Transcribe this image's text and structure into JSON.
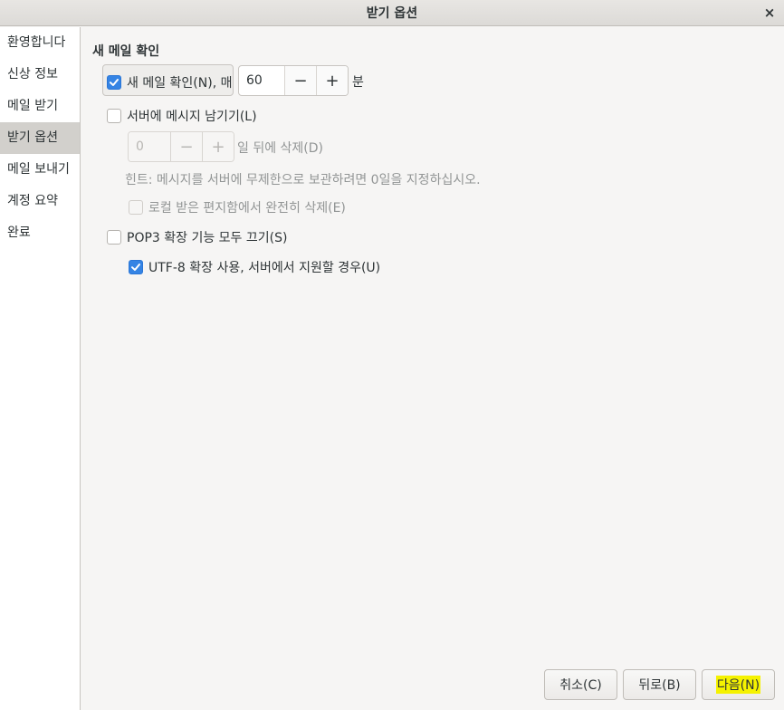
{
  "window": {
    "title": "받기 옵션",
    "close_icon": "×"
  },
  "sidebar": {
    "items": [
      {
        "label": "환영합니다"
      },
      {
        "label": "신상 정보"
      },
      {
        "label": "메일 받기"
      },
      {
        "label": "받기 옵션"
      },
      {
        "label": "메일 보내기"
      },
      {
        "label": "계정 요약"
      },
      {
        "label": "완료"
      }
    ],
    "active_index": 3
  },
  "main": {
    "section_title": "새 메일 확인",
    "check_new_mail": {
      "label": "새 메일 확인(N), 매",
      "checked": true
    },
    "interval": {
      "value": "60",
      "minus": "−",
      "plus": "+",
      "unit": "분"
    },
    "leave_on_server": {
      "label": "서버에 메시지 남기기(L)",
      "checked": false
    },
    "delete_after": {
      "value": "0",
      "minus": "−",
      "plus": "+",
      "unit": "일 뒤에 삭제(D)"
    },
    "hint": "힌트: 메시지를 서버에 무제한으로 보관하려면 0일을 지정하십시오.",
    "delete_local": {
      "label": "로컬 받은 편지함에서 완전히 삭제(E)",
      "checked": false
    },
    "disable_pop3_ext": {
      "label": "POP3 확장 기능 모두 끄기(S)",
      "checked": false
    },
    "utf8": {
      "label": "UTF-8 확장 사용, 서버에서 지원할 경우(U)",
      "checked": true
    }
  },
  "footer": {
    "cancel_label": "취소(C)",
    "back_label": "뒤로(B)",
    "next_label": "다음(N)"
  },
  "colors": {
    "accent": "#3584e4",
    "highlight": "#f5f200"
  }
}
